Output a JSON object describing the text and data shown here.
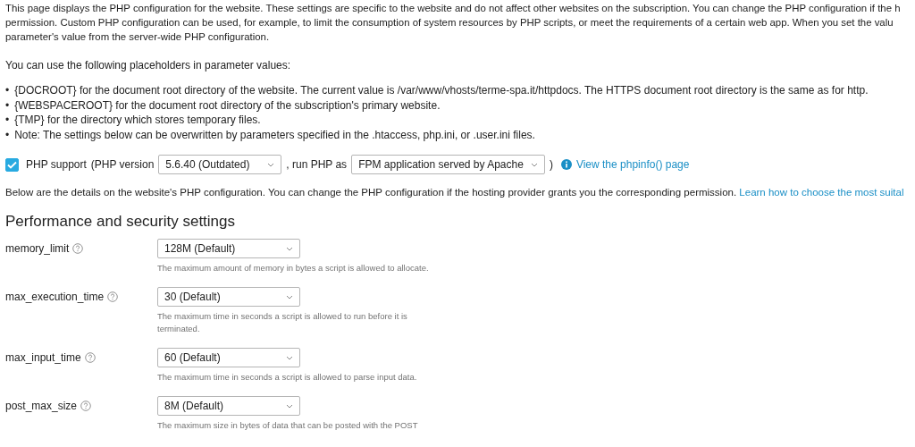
{
  "intro_lines": [
    "This page displays the PHP configuration for the website. These settings are specific to the website and do not affect other websites on the subscription. You can change the PHP configuration if the h",
    "permission. Custom PHP configuration can be used, for example, to limit the consumption of system resources by PHP scripts, or meet the requirements of a certain web app. When you set the valu",
    "parameter's value from the server-wide PHP configuration."
  ],
  "placeholders_intro": "You can use the following placeholders in parameter values:",
  "placeholders": [
    {
      "marker": "•",
      "text": "{DOCROOT} for the document root directory of the website. The current value is /var/www/vhosts/terme-spa.it/httpdocs. The HTTPS document root directory is the same as for http."
    },
    {
      "marker": "•",
      "text": "{WEBSPACEROOT} for the document root directory of the subscription's primary website."
    },
    {
      "marker": "•",
      "text": "{TMP} for the directory which stores temporary files."
    },
    {
      "marker": "•",
      "text": "Note: The settings below can be overwritten by parameters specified in the .htaccess, php.ini, or .user.ini files."
    }
  ],
  "php_support": {
    "checked": true,
    "label": "PHP support",
    "version_prefix": "(PHP version",
    "version": "5.6.40 (Outdated)",
    "run_as_prefix": ", run PHP as",
    "run_as": "FPM application served by Apache",
    "close_paren": ")",
    "link": "View the phpinfo() page"
  },
  "details": {
    "text": "Below are the details on the website's PHP configuration. You can change the PHP configuration if the hosting provider grants you the corresponding permission.",
    "link": "Learn how to choose the most suital"
  },
  "section_title": "Performance and security settings",
  "settings": [
    {
      "name": "memory_limit",
      "value": "128M (Default)",
      "help": "The maximum amount of memory in bytes a script is allowed to allocate."
    },
    {
      "name": "max_execution_time",
      "value": "30 (Default)",
      "help": "The maximum time in seconds a script is allowed to run before it is terminated."
    },
    {
      "name": "max_input_time",
      "value": "60 (Default)",
      "help": "The maximum time in seconds a script is allowed to parse input data."
    },
    {
      "name": "post_max_size",
      "value": "8M (Default)",
      "help": "The maximum size in bytes of data that can be posted with the POST"
    }
  ]
}
